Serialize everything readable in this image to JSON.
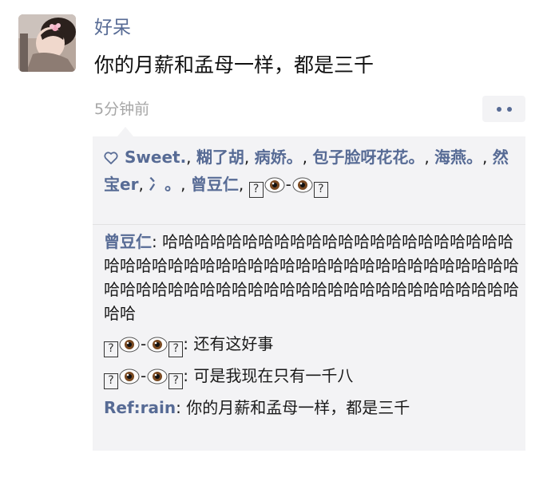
{
  "post": {
    "username": "好呆",
    "text": "你的月薪和孟母一样，都是三千",
    "time": "5分钟前"
  },
  "likes": {
    "names": [
      "Sweet.",
      "糊了胡",
      "病娇。",
      "包子脸呀花花。",
      "海燕。",
      "然宝er",
      "冫。",
      "曾豆仁",
      "?👁-👁?"
    ],
    "separator": ", "
  },
  "comments": [
    {
      "author": "曾豆仁",
      "text": "哈哈哈哈哈哈哈哈哈哈哈哈哈哈哈哈哈哈哈哈哈哈哈哈哈哈哈哈哈哈哈哈哈哈哈哈哈哈哈哈哈哈哈哈哈哈哈哈哈哈哈哈哈哈哈哈哈哈哈哈哈哈哈哈哈哈哈哈哈哈哈哈哈哈哈哈"
    },
    {
      "author": "?👁-👁?",
      "text": "还有这好事"
    },
    {
      "author": "?👁-👁?",
      "text": "可是我现在只有一千八"
    },
    {
      "author": "Ref:rain",
      "text": "你的月薪和孟母一样，都是三千"
    }
  ],
  "colors": {
    "link": "#576b95",
    "panel": "#f3f3f5",
    "time": "#a6a6a6"
  },
  "icons": [
    "avatar",
    "heart-icon",
    "more-options-icon",
    "eye-emoji"
  ]
}
